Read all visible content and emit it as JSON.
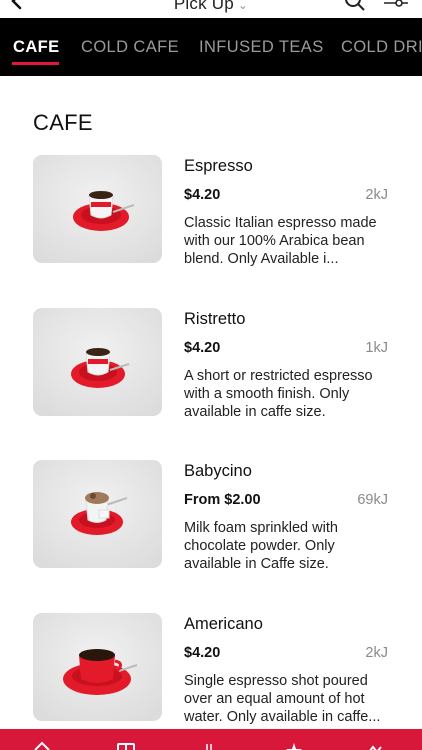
{
  "header": {
    "title": "Pick Up",
    "back_icon": "back-arrow-icon",
    "search_icon": "search-icon",
    "filter_icon": "filter-icon"
  },
  "tabs": [
    {
      "label": "CAFE",
      "active": true
    },
    {
      "label": "COLD CAFE",
      "active": false
    },
    {
      "label": "INFUSED TEAS",
      "active": false
    },
    {
      "label": "COLD DRI",
      "active": false
    }
  ],
  "section": {
    "title": "CAFE"
  },
  "items": [
    {
      "name": "Espresso",
      "price": "$4.20",
      "energy": "2kJ",
      "description": "Classic Italian espresso made with our 100% Arabica bean blend. Only Available i...",
      "image": "espresso-cup"
    },
    {
      "name": "Ristretto",
      "price": "$4.20",
      "energy": "1kJ",
      "description": "A short or restricted espresso with a smooth finish. Only available in caffe size.",
      "image": "ristretto-cup"
    },
    {
      "name": "Babycino",
      "price": "From $2.00",
      "energy": "69kJ",
      "description": "Milk foam sprinkled with chocolate powder. Only available in Caffe size.",
      "image": "babycino-cup"
    },
    {
      "name": "Americano",
      "price": "$4.20",
      "energy": "2kJ",
      "description": "Single espresso shot poured over an equal amount of hot water. Only available in caffe...",
      "image": "americano-cup"
    }
  ],
  "colors": {
    "accent": "#e3193b",
    "tabbar_bg": "#000000",
    "bottom_nav_bg": "#d8183a"
  },
  "bottom_nav": {
    "icons": [
      "home-icon",
      "menu-icon",
      "order-icon",
      "favorites-icon",
      "more-icon"
    ]
  }
}
